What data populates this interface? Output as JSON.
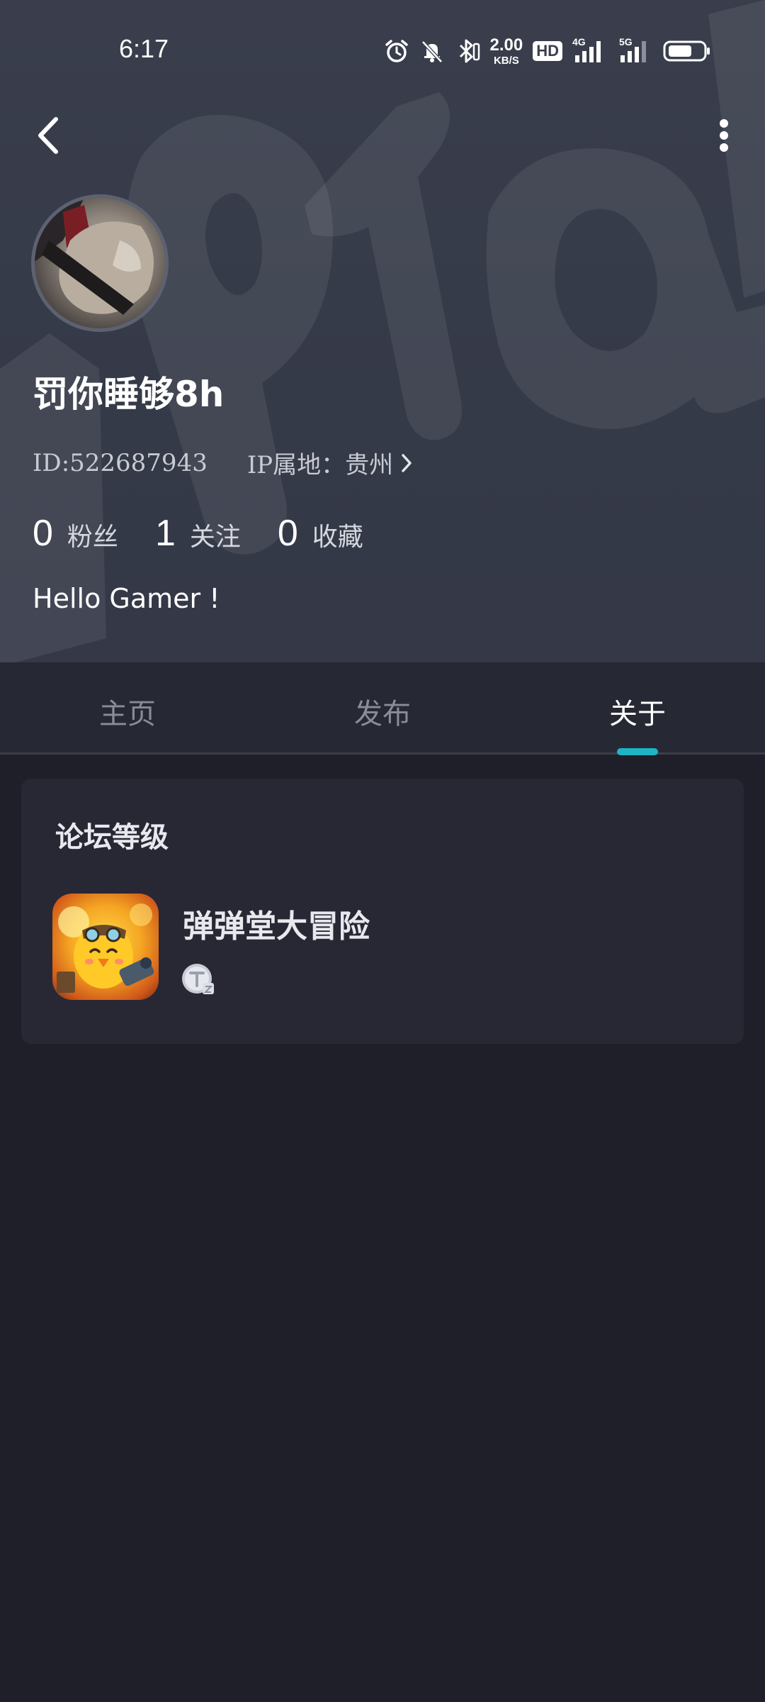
{
  "status_bar": {
    "time": "6:17",
    "net_speed_value": "2.00",
    "net_speed_unit": "KB/S",
    "hd_label": "HD",
    "signal_labels": [
      "4G",
      "5G"
    ]
  },
  "profile": {
    "nickname": "罚你睡够8h",
    "id_text": "ID:522687943",
    "ip_text": "IP属地：贵州",
    "stats": [
      {
        "value": "0",
        "label": "粉丝"
      },
      {
        "value": "1",
        "label": "关注"
      },
      {
        "value": "0",
        "label": "收藏"
      }
    ],
    "bio": "Hello Gamer !"
  },
  "tabs": [
    {
      "label": "主页",
      "active": false
    },
    {
      "label": "发布",
      "active": false
    },
    {
      "label": "关于",
      "active": true
    }
  ],
  "forum_level": {
    "title": "论坛等级",
    "items": [
      {
        "game_name": "弹弹堂大冒险",
        "level_badge_icon": "level-badge-icon"
      }
    ]
  },
  "colors": {
    "accent": "#1fb3c6",
    "header_bg": "#373b49",
    "page_bg": "#1f1f29",
    "card_bg": "#272834"
  }
}
